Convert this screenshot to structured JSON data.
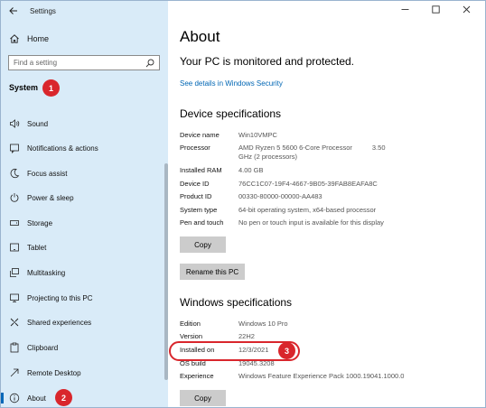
{
  "window": {
    "title": "Settings"
  },
  "sidebar": {
    "home_label": "Home",
    "search_placeholder": "Find a setting",
    "section_title": "System",
    "items": [
      {
        "label": "Sound",
        "icon": "speaker-icon"
      },
      {
        "label": "Notifications & actions",
        "icon": "notification-icon"
      },
      {
        "label": "Focus assist",
        "icon": "moon-icon"
      },
      {
        "label": "Power & sleep",
        "icon": "power-icon"
      },
      {
        "label": "Storage",
        "icon": "storage-icon"
      },
      {
        "label": "Tablet",
        "icon": "tablet-icon"
      },
      {
        "label": "Multitasking",
        "icon": "multitasking-icon"
      },
      {
        "label": "Projecting to this PC",
        "icon": "projector-icon"
      },
      {
        "label": "Shared experiences",
        "icon": "shared-experiences-icon"
      },
      {
        "label": "Clipboard",
        "icon": "clipboard-icon"
      },
      {
        "label": "Remote Desktop",
        "icon": "remote-desktop-icon"
      },
      {
        "label": "About",
        "icon": "info-icon",
        "active": true
      }
    ]
  },
  "annotations": {
    "badge1": "1",
    "badge2": "2",
    "badge3": "3",
    "color": "#d9262c"
  },
  "main": {
    "title": "About",
    "protection_text": "Your PC is monitored and protected.",
    "security_link": "See details in Windows Security",
    "device_heading": "Device specifications",
    "device_specs": [
      {
        "k": "Device name",
        "v": "Win10VMPC"
      },
      {
        "k": "Processor",
        "v": "AMD Ryzen 5 5600 6-Core Processor",
        "v_right": "3.50",
        "v2": "GHz  (2 processors)"
      },
      {
        "k": "Installed RAM",
        "v": "4.00 GB"
      },
      {
        "k": "Device ID",
        "v": "76CC1C07-19F4-4667-9B05-39FAB8EAFA8C"
      },
      {
        "k": "Product ID",
        "v": "00330-80000-00000-AA483"
      },
      {
        "k": "System type",
        "v": "64-bit operating system, x64-based processor"
      },
      {
        "k": "Pen and touch",
        "v": "No pen or touch input is available for this display"
      }
    ],
    "copy_label": "Copy",
    "rename_label": "Rename this PC",
    "windows_heading": "Windows specifications",
    "windows_specs": [
      {
        "k": "Edition",
        "v": "Windows 10 Pro"
      },
      {
        "k": "Version",
        "v": "22H2"
      },
      {
        "k": "Installed on",
        "v": "12/3/2021"
      },
      {
        "k": "OS build",
        "v": "19045.3208"
      },
      {
        "k": "Experience",
        "v": "Windows Feature Experience Pack 1000.19041.1000.0"
      }
    ],
    "copy2_label": "Copy"
  },
  "colors": {
    "sidebar_bg": "#d9ebf8",
    "link": "#0066b4",
    "accent": "#0067b8"
  }
}
